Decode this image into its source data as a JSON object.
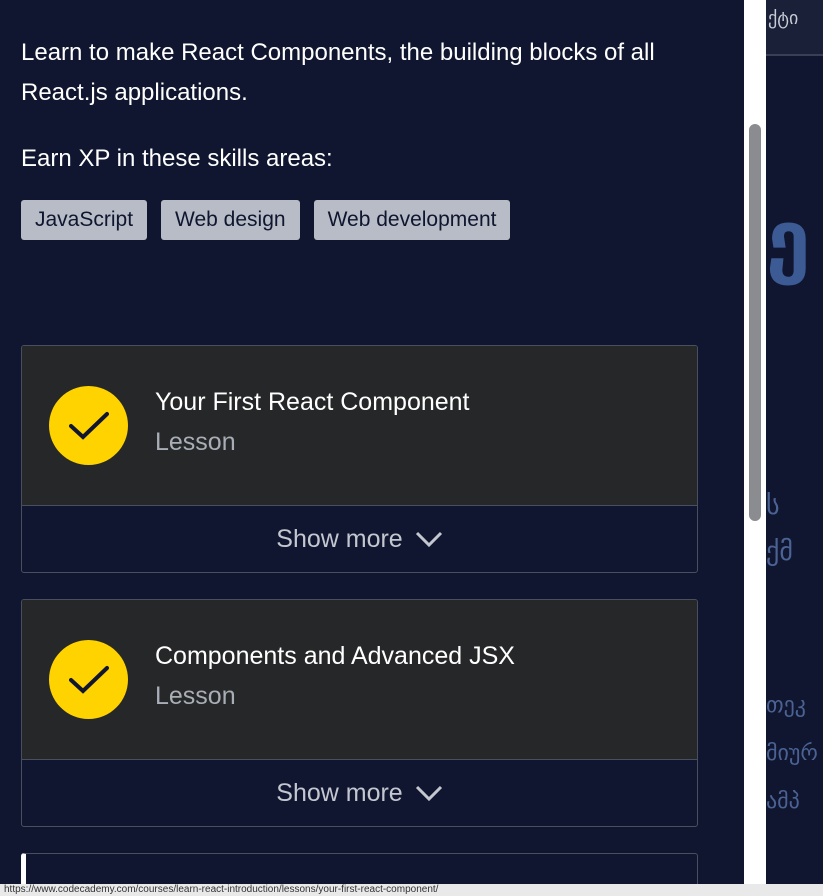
{
  "description": "Learn to make React Components, the building blocks of all React.js applications.",
  "skills_heading": "Earn XP in these skills areas:",
  "skills": [
    "JavaScript",
    "Web design",
    "Web development"
  ],
  "items": [
    {
      "title": "Your First React Component",
      "type": "Lesson",
      "show_more": "Show more"
    },
    {
      "title": "Components and Advanced JSX",
      "type": "Lesson",
      "show_more": "Show more"
    }
  ],
  "background": {
    "top_text": "ქტი"
  },
  "status_url": "https://www.codecademy.com/courses/learn-react-introduction/lessons/your-first-react-component/",
  "colors": {
    "accent": "#ffd300",
    "background": "#10162f",
    "card": "#262728"
  }
}
